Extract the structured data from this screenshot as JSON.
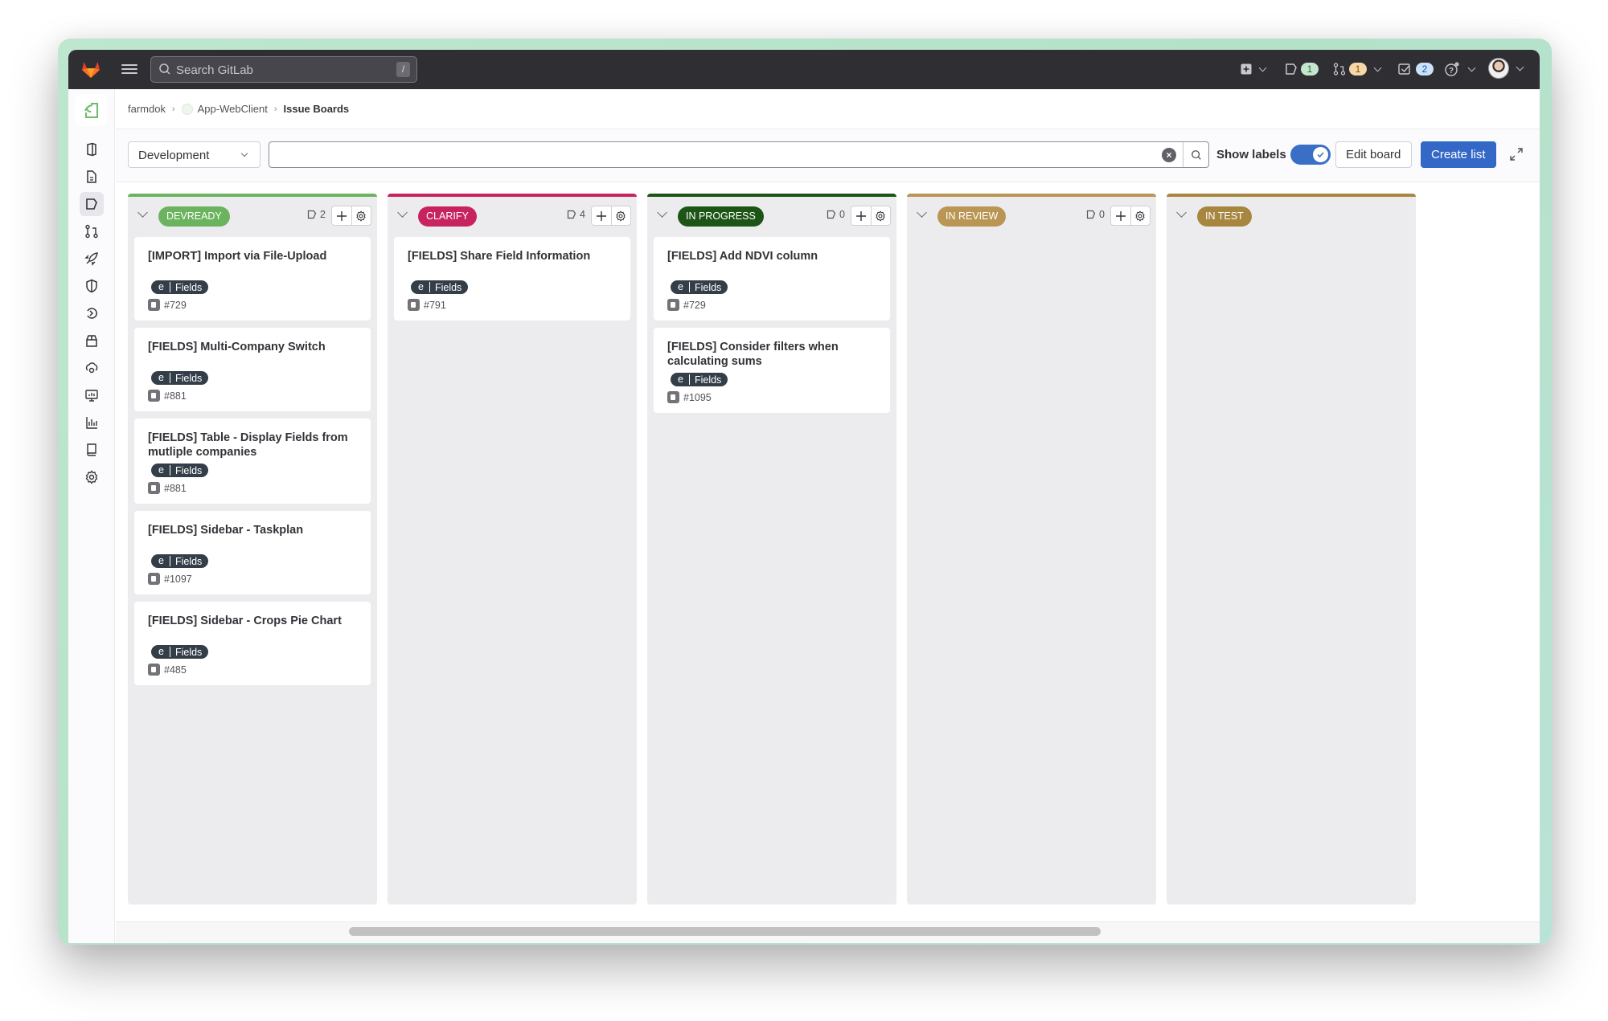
{
  "topbar": {
    "search_placeholder": "Search GitLab",
    "search_shortcut": "/",
    "issues_count": "1",
    "merge_requests_count": "1",
    "todos_count": "2",
    "colors": {
      "issues_badge": "#c3e6cd",
      "mr_badge": "#f5d9a8",
      "todos_badge": "#cbe2f9"
    }
  },
  "sidebar": {
    "items": [
      {
        "icon": "project-overview-icon"
      },
      {
        "icon": "repository-icon"
      },
      {
        "icon": "issues-icon",
        "active": true
      },
      {
        "icon": "merge-requests-icon"
      },
      {
        "icon": "ci-cd-rocket-icon"
      },
      {
        "icon": "security-shield-icon"
      },
      {
        "icon": "deployments-icon"
      },
      {
        "icon": "packages-icon"
      },
      {
        "icon": "infrastructure-icon"
      },
      {
        "icon": "monitor-icon"
      },
      {
        "icon": "analytics-icon"
      },
      {
        "icon": "wiki-icon"
      },
      {
        "icon": "settings-gear-icon"
      }
    ],
    "expand_label": "»"
  },
  "breadcrumb": {
    "items": [
      "farmdok",
      "App-WebClient",
      "Issue Boards"
    ]
  },
  "filterbar": {
    "board_select": "Development",
    "filter_value": "",
    "show_labels": "Show labels",
    "show_labels_enabled": true,
    "edit_board": "Edit board",
    "create_list": "Create list"
  },
  "lists": [
    {
      "title": "DEVREADY",
      "color": "#6bb35e",
      "count": "2",
      "cards": [
        {
          "title": "[IMPORT] Import via File-Upload",
          "label_scope": "e",
          "label_value": "Fields",
          "ref": "#729"
        },
        {
          "title": "[FIELDS] Multi-Company Switch",
          "label_scope": "e",
          "label_value": "Fields",
          "ref": "#881"
        },
        {
          "title": "[FIELDS] Table - Display Fields from mutliple companies",
          "label_scope": "e",
          "label_value": "Fields",
          "ref": "#881"
        },
        {
          "title": "[FIELDS] Sidebar - Taskplan",
          "label_scope": "e",
          "label_value": "Fields",
          "ref": "#1097"
        },
        {
          "title": "[FIELDS] Sidebar - Crops Pie Chart",
          "label_scope": "e",
          "label_value": "Fields",
          "ref": "#485"
        }
      ]
    },
    {
      "title": "CLARIFY",
      "color": "#c7245f",
      "count": "4",
      "cards": [
        {
          "title": "[FIELDS] Share Field Information",
          "label_scope": "e",
          "label_value": "Fields",
          "ref": "#791"
        }
      ]
    },
    {
      "title": "IN PROGRESS",
      "color": "#1c5515",
      "count": "0",
      "cards": [
        {
          "title": "[FIELDS] Add NDVI column",
          "label_scope": "e",
          "label_value": "Fields",
          "ref": "#729"
        },
        {
          "title": "[FIELDS] Consider filters when calculating sums",
          "label_scope": "e",
          "label_value": "Fields",
          "ref": "#1095"
        }
      ]
    },
    {
      "title": "IN REVIEW",
      "color": "#b99654",
      "count": "0",
      "cards": []
    },
    {
      "title": "IN TEST",
      "color": "#a78640",
      "count": "",
      "cards": []
    }
  ]
}
